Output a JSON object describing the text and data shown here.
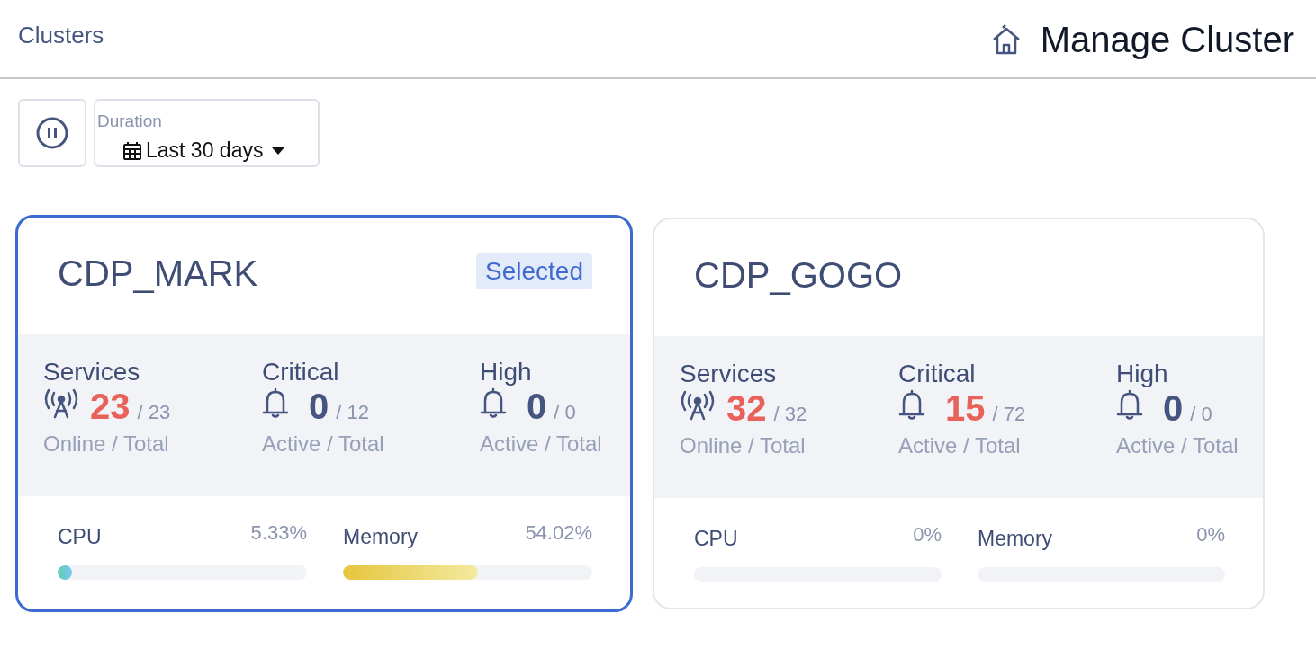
{
  "header": {
    "breadcrumb": "Clusters",
    "title": "Manage Cluster"
  },
  "toolbar": {
    "duration_label": "Duration",
    "duration_value": "Last 30 days"
  },
  "clusters": [
    {
      "name": "CDP_MARK",
      "selected": true,
      "badge": "Selected",
      "stats": [
        {
          "kind": "services",
          "label": "Services",
          "value": "23",
          "total": "/ 23",
          "caption": "Online / Total",
          "alert": true
        },
        {
          "kind": "alerts",
          "label": "Critical",
          "value": "0",
          "total": "/ 12",
          "caption": "Active / Total",
          "alert": false
        },
        {
          "kind": "alerts",
          "label": "High",
          "value": "0",
          "total": "/ 0",
          "caption": "Active / Total",
          "alert": false
        }
      ],
      "resources": [
        {
          "kind": "cpu",
          "label": "CPU",
          "reading": "5.33%",
          "level": 0.0533
        },
        {
          "kind": "memory",
          "label": "Memory",
          "reading": "54.02%",
          "level": 0.5402
        }
      ]
    },
    {
      "name": "CDP_GOGO",
      "selected": false,
      "stats": [
        {
          "kind": "services",
          "label": "Services",
          "value": "32",
          "total": "/ 32",
          "caption": "Online / Total",
          "alert": true
        },
        {
          "kind": "alerts",
          "label": "Critical",
          "value": "15",
          "total": "/ 72",
          "caption": "Active / Total",
          "alert": true
        },
        {
          "kind": "alerts",
          "label": "High",
          "value": "0",
          "total": "/ 0",
          "caption": "Active / Total",
          "alert": false
        }
      ],
      "resources": [
        {
          "kind": "cpu",
          "label": "CPU",
          "reading": "0%",
          "level": 0
        },
        {
          "kind": "memory",
          "label": "Memory",
          "reading": "0%",
          "level": 0
        }
      ]
    }
  ]
}
